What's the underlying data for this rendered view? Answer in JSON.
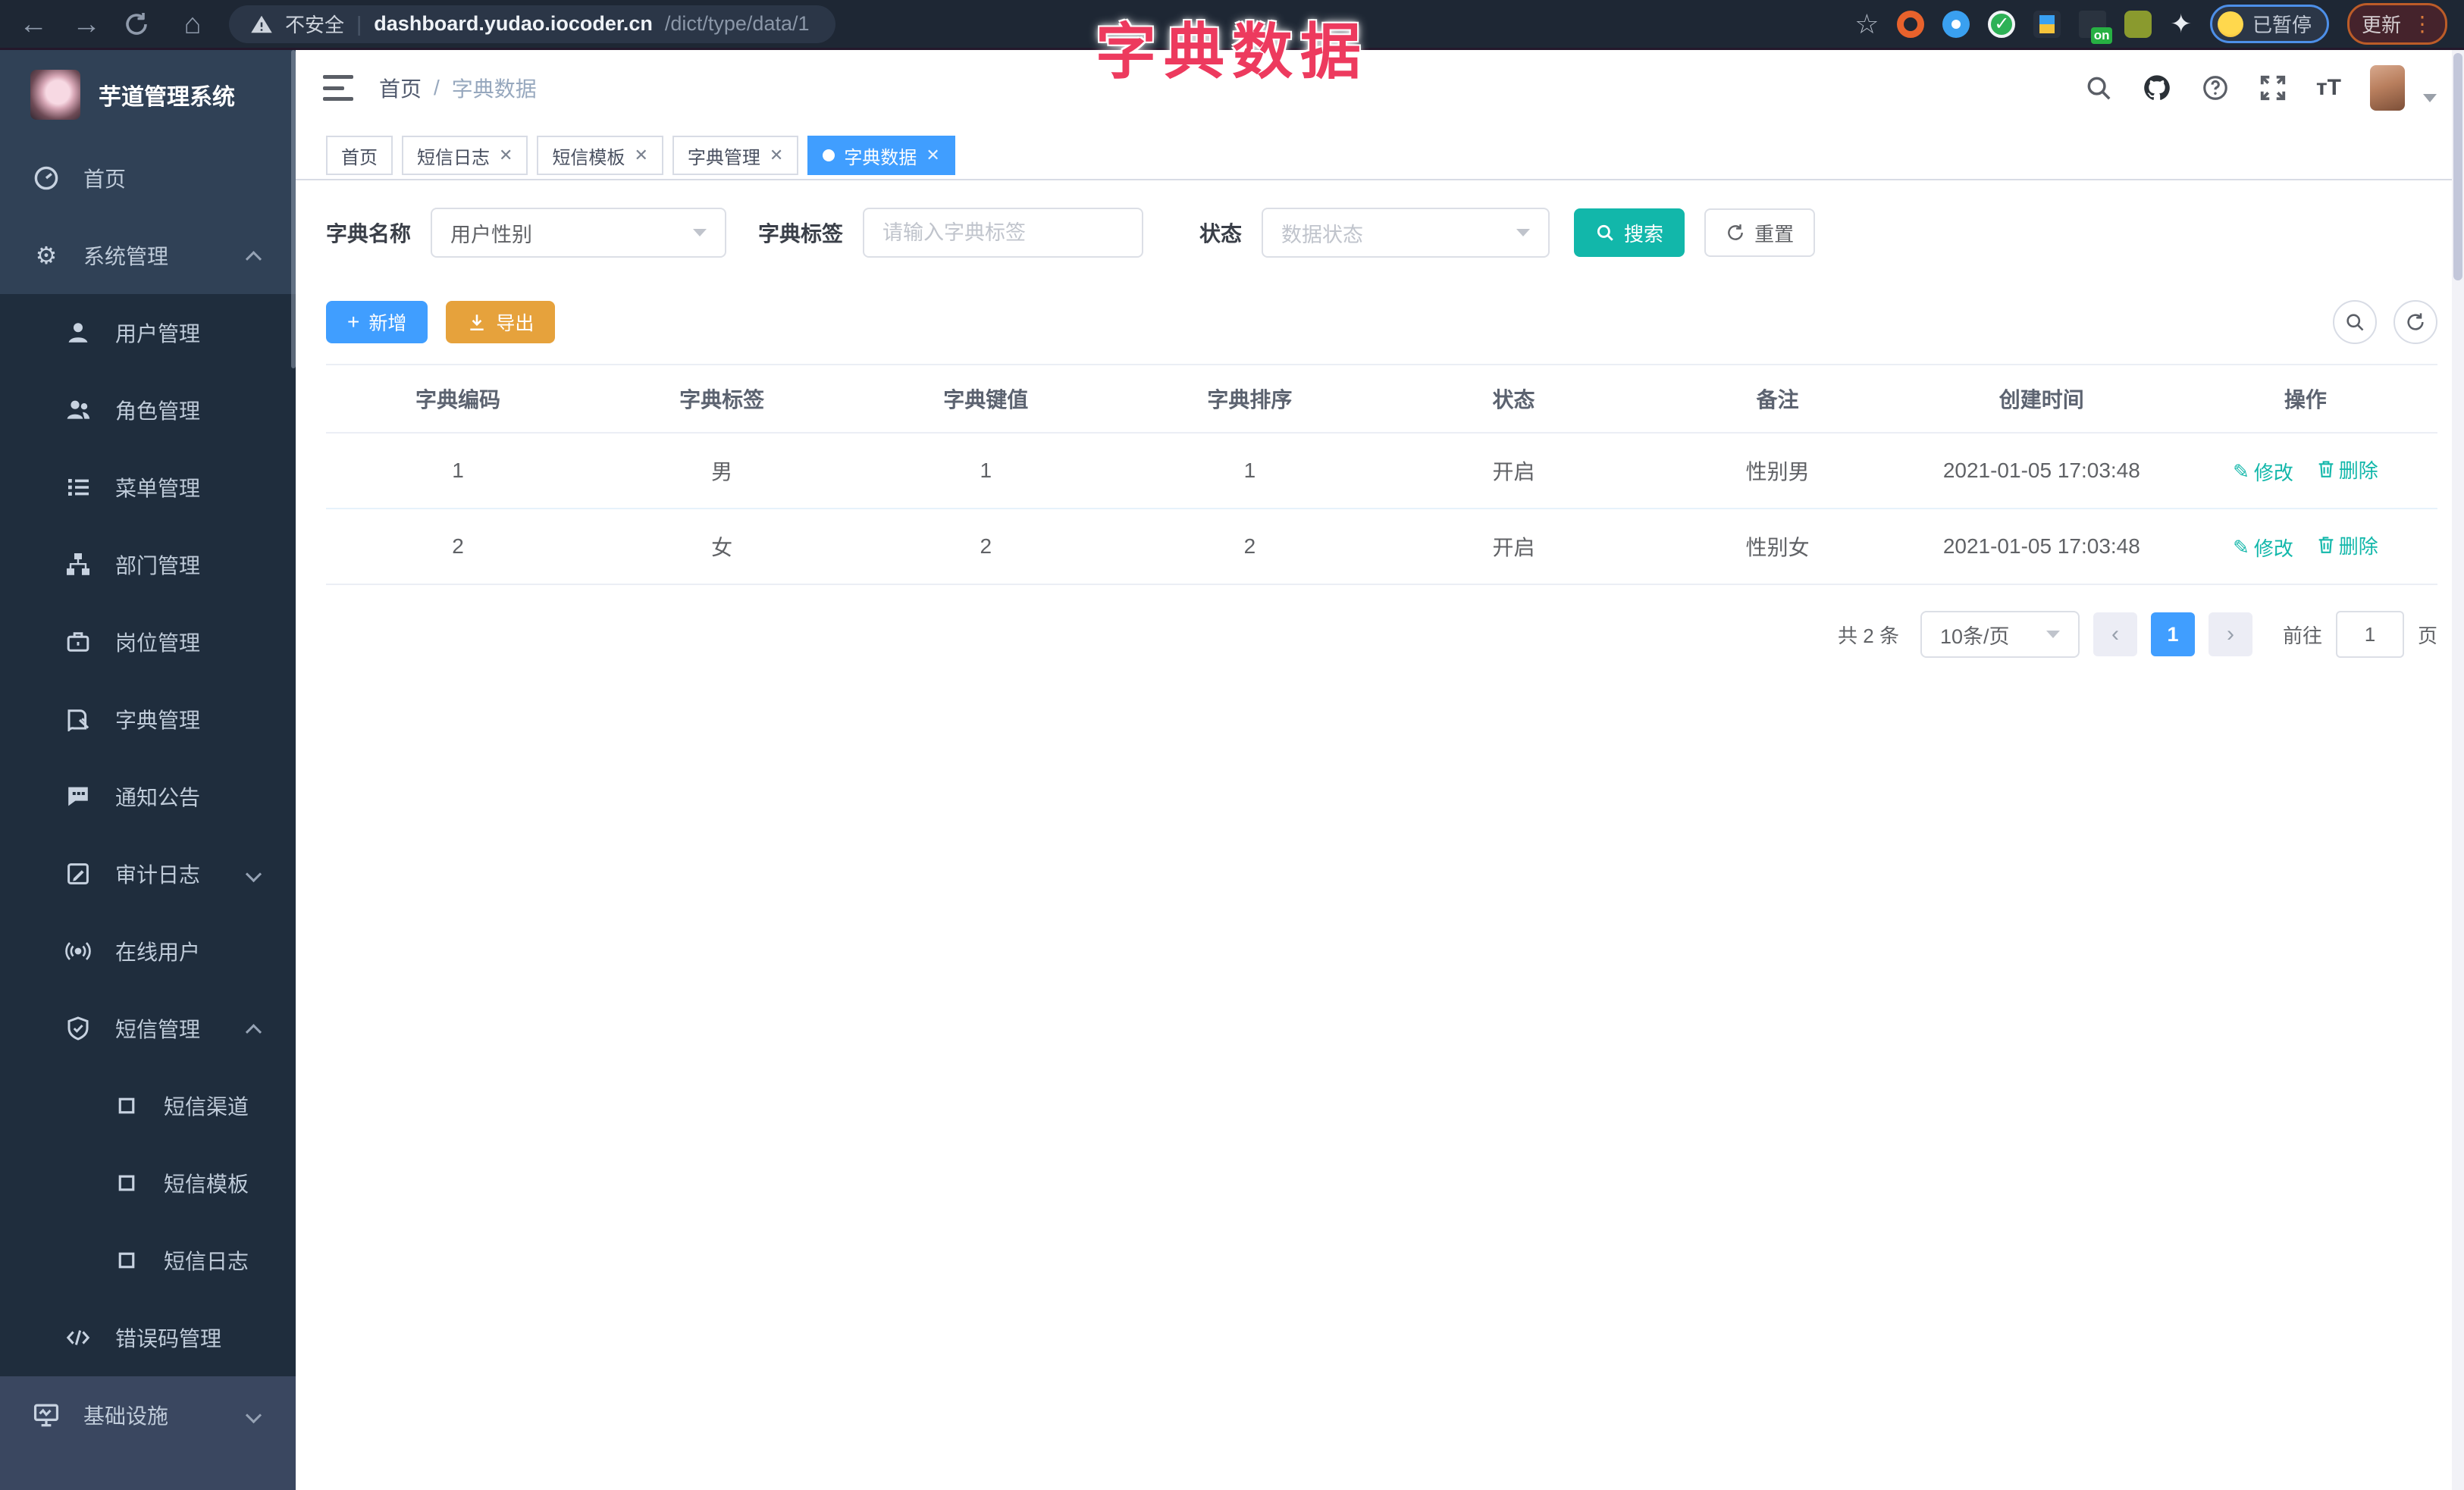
{
  "browser": {
    "security_label": "不安全",
    "url_host": "dashboard.yudao.iocoder.cn",
    "url_path": "/dict/type/data/1",
    "extension_badge": "on",
    "profile_chip_label": "已暂停",
    "update_button_label": "更新"
  },
  "overlay_title": "字典数据",
  "sidebar": {
    "app_title": "芋道管理系统",
    "items": [
      {
        "label": "首页"
      },
      {
        "label": "系统管理"
      },
      {
        "label": "用户管理"
      },
      {
        "label": "角色管理"
      },
      {
        "label": "菜单管理"
      },
      {
        "label": "部门管理"
      },
      {
        "label": "岗位管理"
      },
      {
        "label": "字典管理"
      },
      {
        "label": "通知公告"
      },
      {
        "label": "审计日志"
      },
      {
        "label": "在线用户"
      },
      {
        "label": "短信管理"
      },
      {
        "label": "短信渠道"
      },
      {
        "label": "短信模板"
      },
      {
        "label": "短信日志"
      },
      {
        "label": "错误码管理"
      },
      {
        "label": "基础设施"
      }
    ]
  },
  "navbar": {
    "breadcrumb": {
      "home": "首页",
      "separator": "/",
      "current": "字典数据"
    },
    "size_icon_label": "тT"
  },
  "tabs": [
    {
      "label": "首页"
    },
    {
      "label": "短信日志"
    },
    {
      "label": "短信模板"
    },
    {
      "label": "字典管理"
    },
    {
      "label": "字典数据"
    }
  ],
  "filters": {
    "dict_name_label": "字典名称",
    "dict_name_value": "用户性别",
    "dict_label_label": "字典标签",
    "dict_label_placeholder": "请输入字典标签",
    "status_label": "状态",
    "status_placeholder": "数据状态",
    "search_label": "搜索",
    "reset_label": "重置"
  },
  "toolbar": {
    "add_label": "新增",
    "export_label": "导出"
  },
  "table": {
    "headers": [
      "字典编码",
      "字典标签",
      "字典键值",
      "字典排序",
      "状态",
      "备注",
      "创建时间",
      "操作"
    ],
    "rows": [
      {
        "code": "1",
        "label": "男",
        "value": "1",
        "sort": "1",
        "status": "开启",
        "remark": "性别男",
        "created": "2021-01-05 17:03:48",
        "edit": "修改",
        "delete": "删除"
      },
      {
        "code": "2",
        "label": "女",
        "value": "2",
        "sort": "2",
        "status": "开启",
        "remark": "性别女",
        "created": "2021-01-05 17:03:48",
        "edit": "修改",
        "delete": "删除"
      }
    ]
  },
  "pagination": {
    "total": "共 2 条",
    "page_size": "10条/页",
    "page": "1",
    "goto_label": "前往",
    "goto_value": "1",
    "unit_label": "页"
  },
  "colors": {
    "primary_blue": "#409eff",
    "teal": "#12b7aa",
    "warning_orange": "#e6a23c",
    "overlay_pink": "#ed3a5e",
    "sidebar_bg": "#304156",
    "submenu_bg": "#1f2d3d"
  }
}
